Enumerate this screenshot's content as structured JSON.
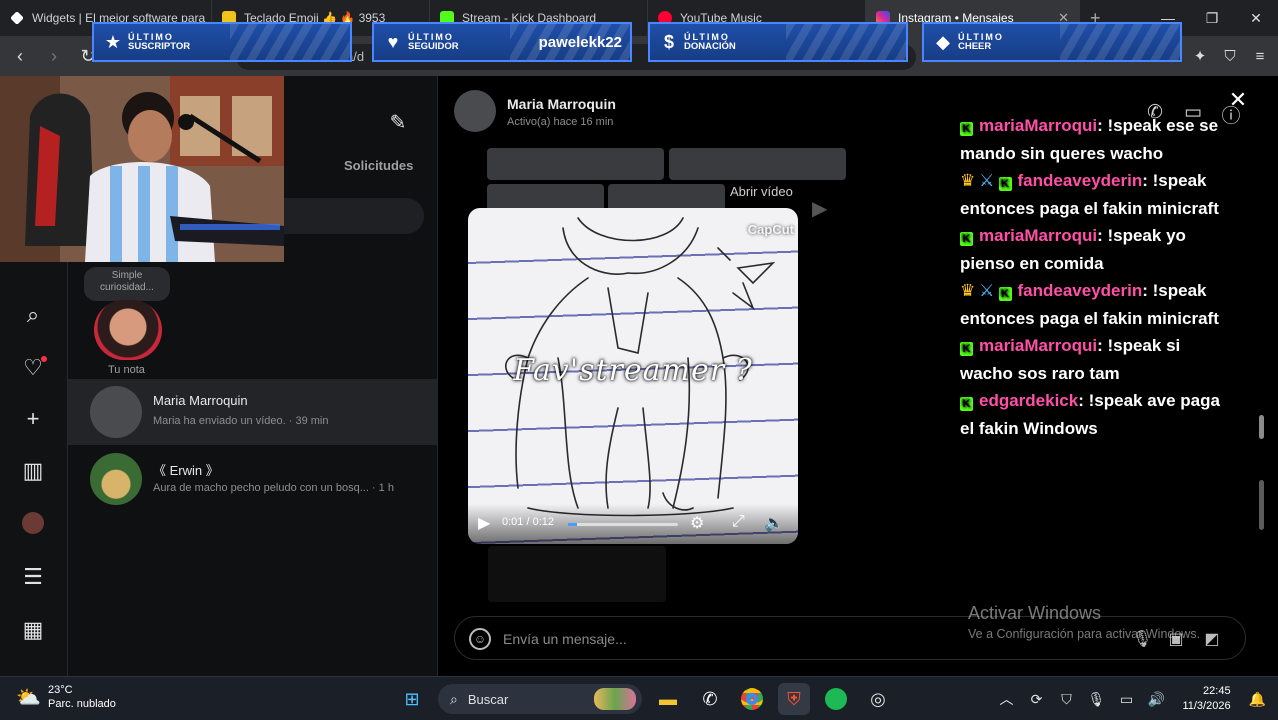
{
  "browser": {
    "tabs": [
      {
        "title": "Widgets | El mejor software para",
        "icon_color": "#ffffff",
        "active": false
      },
      {
        "title": "Teclado Emoji 👍 🔥 3953",
        "icon_color": "#f0c419",
        "active": false
      },
      {
        "title": "Stream - Kick Dashboard",
        "icon_color": "#53fc18",
        "active": false
      },
      {
        "title": "YouTube Music",
        "icon_color": "#ff0033",
        "active": false
      },
      {
        "title": "Instagram • Mensajes",
        "icon_color": "#d6249f",
        "active": true
      }
    ],
    "new_tab": "+",
    "url_fragment": "a/d"
  },
  "overlay_alerts": [
    {
      "line1": "ÚLTIMO",
      "line2": "SUSCRIPTOR",
      "icon": "star-icon",
      "glyph": "★",
      "name": ""
    },
    {
      "line1": "ÚLTIMO",
      "line2": "SEGUIDOR",
      "icon": "heart-icon",
      "glyph": "♥",
      "name": "pawelekk22"
    },
    {
      "line1": "ÚLTIMO",
      "line2": "DONACIÓN",
      "icon": "dollar-icon",
      "glyph": "$",
      "name": ""
    },
    {
      "line1": "ÚLTIMO",
      "line2": "CHEER",
      "icon": "diamond-icon",
      "glyph": "◆",
      "name": ""
    }
  ],
  "inbox": {
    "requests_label": "Solicitudes",
    "note_bubble": [
      "Simple",
      "curiosidad..."
    ],
    "note_label": "Tu nota",
    "conversations": [
      {
        "name": "Maria Marroquin",
        "preview": "Maria ha enviado un vídeo. · 39 min",
        "selected": true
      },
      {
        "name": "《 Erwin 》",
        "preview": "Aura de macho pecho peludo con un bosq... · 1 h",
        "selected": false
      }
    ]
  },
  "thread": {
    "name": "Maria Marroquin",
    "status": "Activo(a) hace 16 min",
    "open_video": "Abrir vídeo",
    "composer_placeholder": "Envía un mensaje..."
  },
  "video": {
    "watermark": "CapCut",
    "caption": "Fav'streamer ?",
    "time": "0:01 / 0:12",
    "progress": 0.08
  },
  "chat": [
    {
      "badges": [
        "kick"
      ],
      "user": "mariaMarroqui",
      "text": ": !speak ese se mando sin queres wacho"
    },
    {
      "badges": [
        "crown",
        "sword",
        "kick"
      ],
      "user": "fandeaveyderin",
      "text": ": !speak entonces paga el fakin minicraft"
    },
    {
      "badges": [
        "kick"
      ],
      "user": "mariaMarroqui",
      "text": ": !speak yo pienso en comida"
    },
    {
      "badges": [
        "crown",
        "sword",
        "kick"
      ],
      "user": "fandeaveyderin",
      "text": ": !speak entonces paga el fakin minicraft"
    },
    {
      "badges": [
        "kick"
      ],
      "user": "mariaMarroqui",
      "text": ": !speak si wacho sos raro tam"
    },
    {
      "badges": [
        "kick"
      ],
      "user": "edgardekick",
      "text": ": !speak ave paga el fakin Windows"
    }
  ],
  "windows_watermark": {
    "title": "Activar Windows",
    "subtitle": "Ve a Configuración para activar Windows."
  },
  "taskbar": {
    "temperature": "23°C",
    "weather": "Parc. nublado",
    "search_label": "Buscar",
    "time": "22:45",
    "date": "11/3/2026"
  }
}
